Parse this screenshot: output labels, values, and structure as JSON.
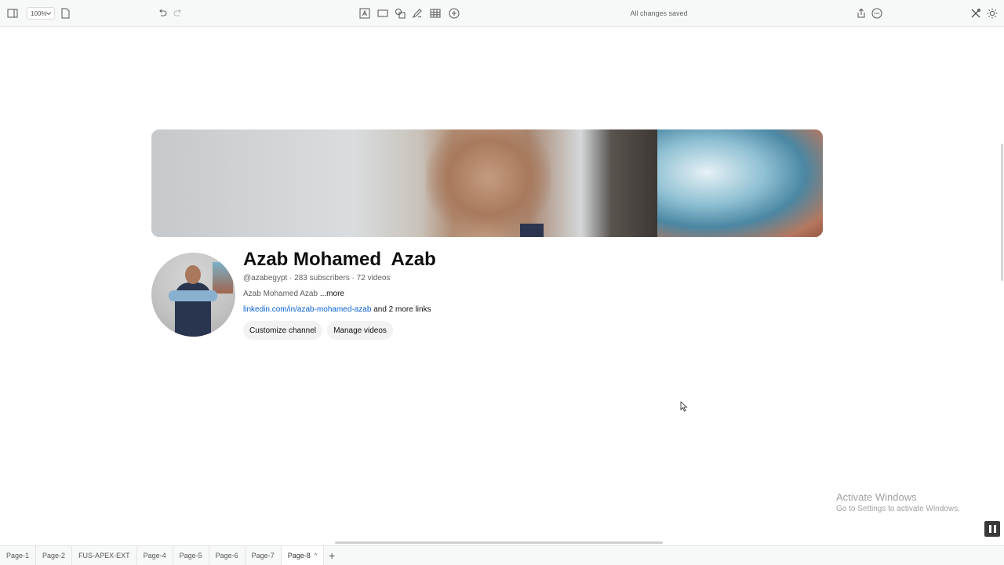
{
  "toolbar": {
    "zoom_value": "100%",
    "status": "All changes saved",
    "icons": [
      "sidebar-toggle-icon",
      "page-icon",
      "undo-icon",
      "redo-icon",
      "text-frame-icon",
      "rectangle-icon",
      "shapes-icon",
      "pen-icon",
      "table-icon",
      "add-circle-icon",
      "share-icon",
      "more-options-icon",
      "tools-icon",
      "theme-icon"
    ]
  },
  "channel": {
    "name": "Azab Mohamed  Azab",
    "meta": "@azabegypt · 283 subscribers · 72 videos",
    "description": "Azab Mohamed Azab ",
    "more_label": "...more",
    "link": "linkedin.com/in/azab-mohamed-azab",
    "extra_links": " and 2 more links",
    "customize_label": "Customize channel",
    "manage_label": "Manage videos"
  },
  "watermark": {
    "title": "Activate Windows",
    "subtitle": "Go to Settings to activate Windows."
  },
  "tabs": [
    {
      "label": "Page-1",
      "active": false
    },
    {
      "label": "Page-2",
      "active": false
    },
    {
      "label": "FUS-APEX-EXT",
      "active": false
    },
    {
      "label": "Page-4",
      "active": false
    },
    {
      "label": "Page-5",
      "active": false
    },
    {
      "label": "Page-6",
      "active": false
    },
    {
      "label": "Page-7",
      "active": false
    },
    {
      "label": "Page-8",
      "active": true
    }
  ],
  "colors": {
    "link": "#065fd4",
    "button_bg": "#f2f2f2",
    "toolbar_bg": "#f7f8f8"
  }
}
